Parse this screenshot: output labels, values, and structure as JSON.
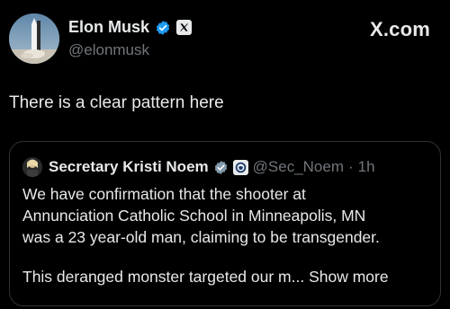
{
  "header": {
    "name": "Elon Musk",
    "handle": "@elonmusk",
    "brand": "X.com",
    "verified_color": "#1d9bf0",
    "affiliate_icon": "x-logo-icon"
  },
  "post": {
    "text": "There is a clear pattern here"
  },
  "quoted_post": {
    "name": "Secretary Kristi Noem",
    "handle": "@Sec_Noem",
    "separator": "·",
    "time": "1h",
    "verified_color": "#829aab",
    "affiliate_icon": "dhs-seal-icon",
    "lines": [
      "We have confirmation that the shooter at",
      "Annunciation Catholic School in Minneapolis, MN",
      "was a 23 year-old man, claiming to be transgender."
    ],
    "last_line": "This deranged monster targeted our m...",
    "show_more": "Show more"
  },
  "colors": {
    "background": "#000000",
    "text_primary": "#e7e9ea",
    "text_secondary": "#71767b",
    "border": "#2f3336"
  }
}
